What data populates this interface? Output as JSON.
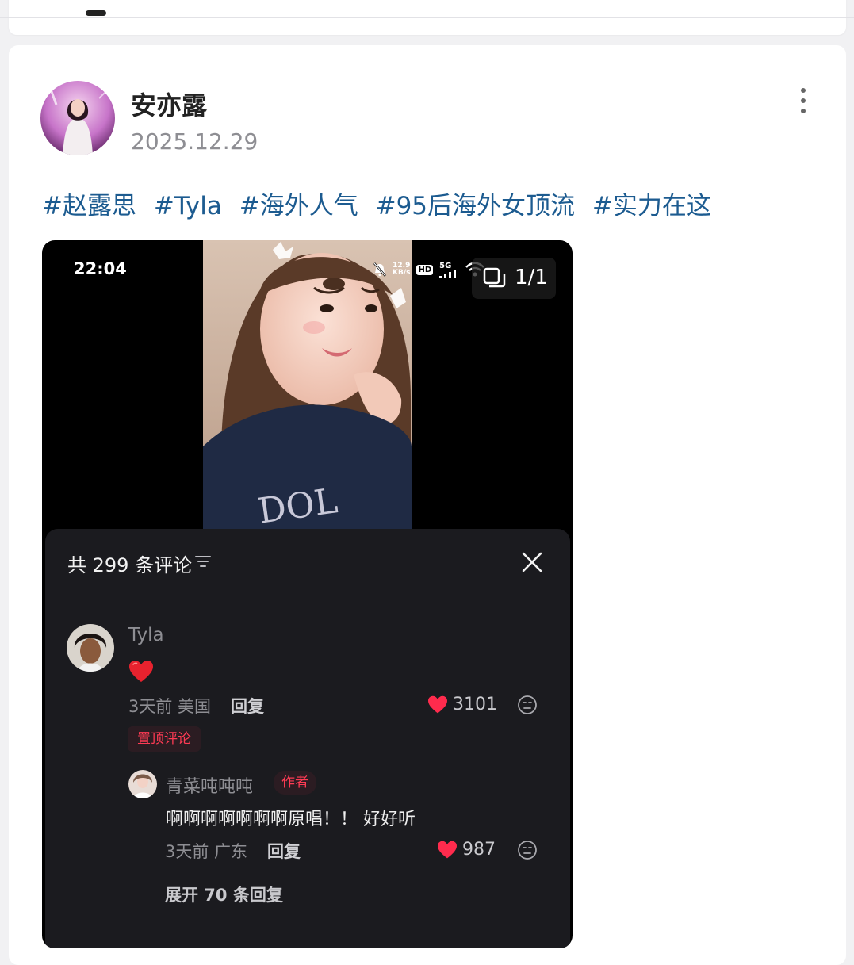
{
  "post": {
    "author": "安亦露",
    "date": "2025.12.29",
    "hashtags": [
      "#赵露思",
      "#Tyla",
      "#海外人气",
      "#95后海外女顶流",
      "#实力在这"
    ]
  },
  "screenshot": {
    "status_time": "22:04",
    "net_speed_top": "12.9",
    "net_speed_unit": "KB/s",
    "hd": "HD",
    "network": "5G",
    "page_counter": "1/1",
    "comments": {
      "title": "共 299 条评论",
      "top_comment": {
        "name": "Tyla",
        "content_icon": "red-heart",
        "time_location": "3天前 美国",
        "reply_label": "回复",
        "likes": "3101",
        "pinned_label": "置顶评论"
      },
      "reply": {
        "name": "青菜吨吨吨",
        "author_badge": "作者",
        "text": "啊啊啊啊啊啊啊原唱！！ 好好听",
        "time_location": "3天前 广东",
        "reply_label": "回复",
        "likes": "987"
      },
      "expand_label": "展开 70 条回复"
    }
  },
  "colors": {
    "hashtag": "#1c5b90",
    "like_red": "#ff2b4d",
    "panel_bg": "#1b1b1f"
  }
}
